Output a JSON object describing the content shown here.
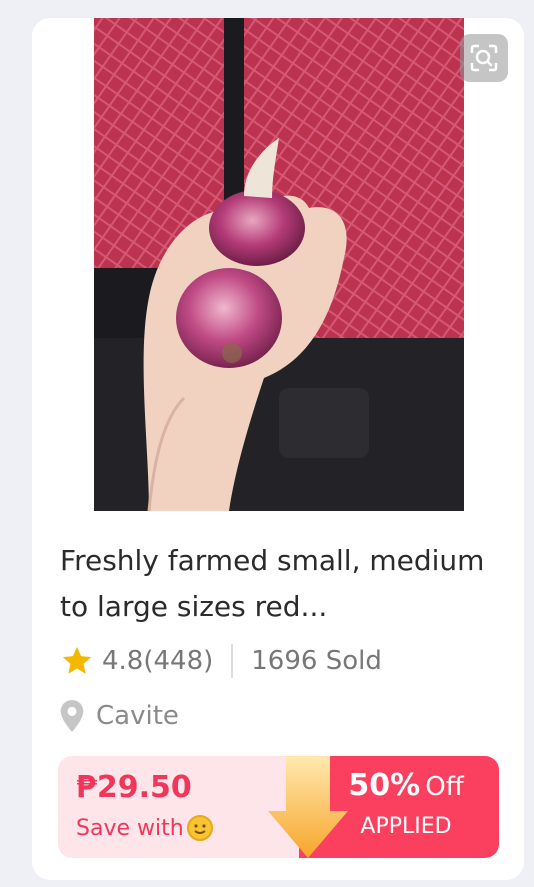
{
  "product": {
    "title": "Freshly farmed small, medium to large sizes red...",
    "rating": "4.8(448)",
    "sold": "1696 Sold",
    "location": "Cavite"
  },
  "promo": {
    "price": "₱29.50",
    "save_label": "Save with",
    "discount_pct": "50%",
    "discount_word": "Off",
    "applied": "APPLIED"
  },
  "icons": {
    "scan": "scan-search-icon",
    "star": "star-icon",
    "pin": "location-pin-icon",
    "coin": "coin-icon"
  },
  "colors": {
    "accent": "#f1365a",
    "promo_bg": "#fde5ea",
    "promo_right": "#fb3f5f",
    "star": "#f5b800"
  }
}
